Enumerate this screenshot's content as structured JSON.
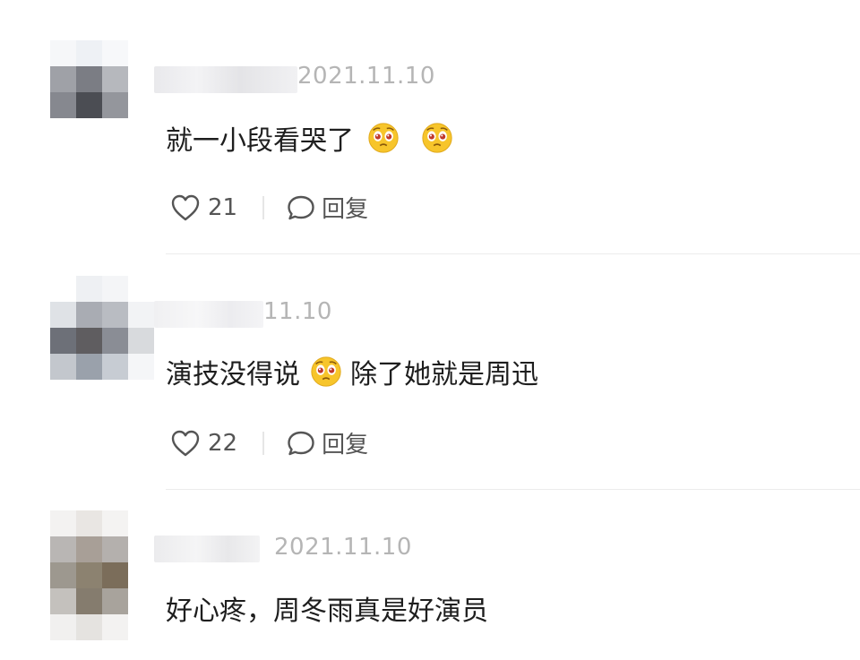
{
  "comments": [
    {
      "date": "2021.11.10",
      "text_parts": [
        "就一小段看哭了",
        "",
        ""
      ],
      "emoji": "pleading-face-emoji",
      "likes": "21",
      "reply_label": "回复"
    },
    {
      "date": "11.10",
      "text_parts": [
        "演技没得说",
        "除了她就是周迅"
      ],
      "emoji": "pleading-face-emoji",
      "likes": "22",
      "reply_label": "回复"
    },
    {
      "date": "2021.11.10",
      "text": "好心疼，周冬雨真是好演员"
    }
  ],
  "colors": {
    "date": "#b5b5b5",
    "icon": "#555555",
    "divider": "#ececec",
    "emoji_face": "#f7c52b"
  }
}
